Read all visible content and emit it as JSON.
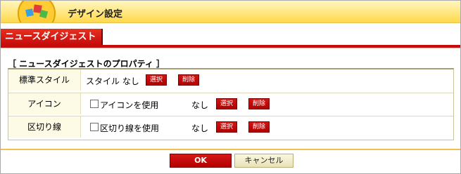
{
  "window": {
    "title": "デザイン設定"
  },
  "tab": {
    "label": "ニュースダイジェスト"
  },
  "section": {
    "title": "［ ニュースダイジェストのプロパティ ］"
  },
  "rows": [
    {
      "label": "標準スタイル",
      "value": "スタイル なし",
      "select": "選択",
      "delete": "削除"
    },
    {
      "label": "アイコン",
      "checkbox_label": "アイコンを使用",
      "value": "なし",
      "select": "選択",
      "delete": "削除"
    },
    {
      "label": "区切り線",
      "checkbox_label": "区切り線を使用",
      "value": "なし",
      "select": "選択",
      "delete": "削除"
    }
  ],
  "footer": {
    "ok": "OK",
    "cancel": "キャンセル"
  },
  "colors": {
    "accent_red": "#c80a0a",
    "header_yellow": "#ffe57a"
  }
}
